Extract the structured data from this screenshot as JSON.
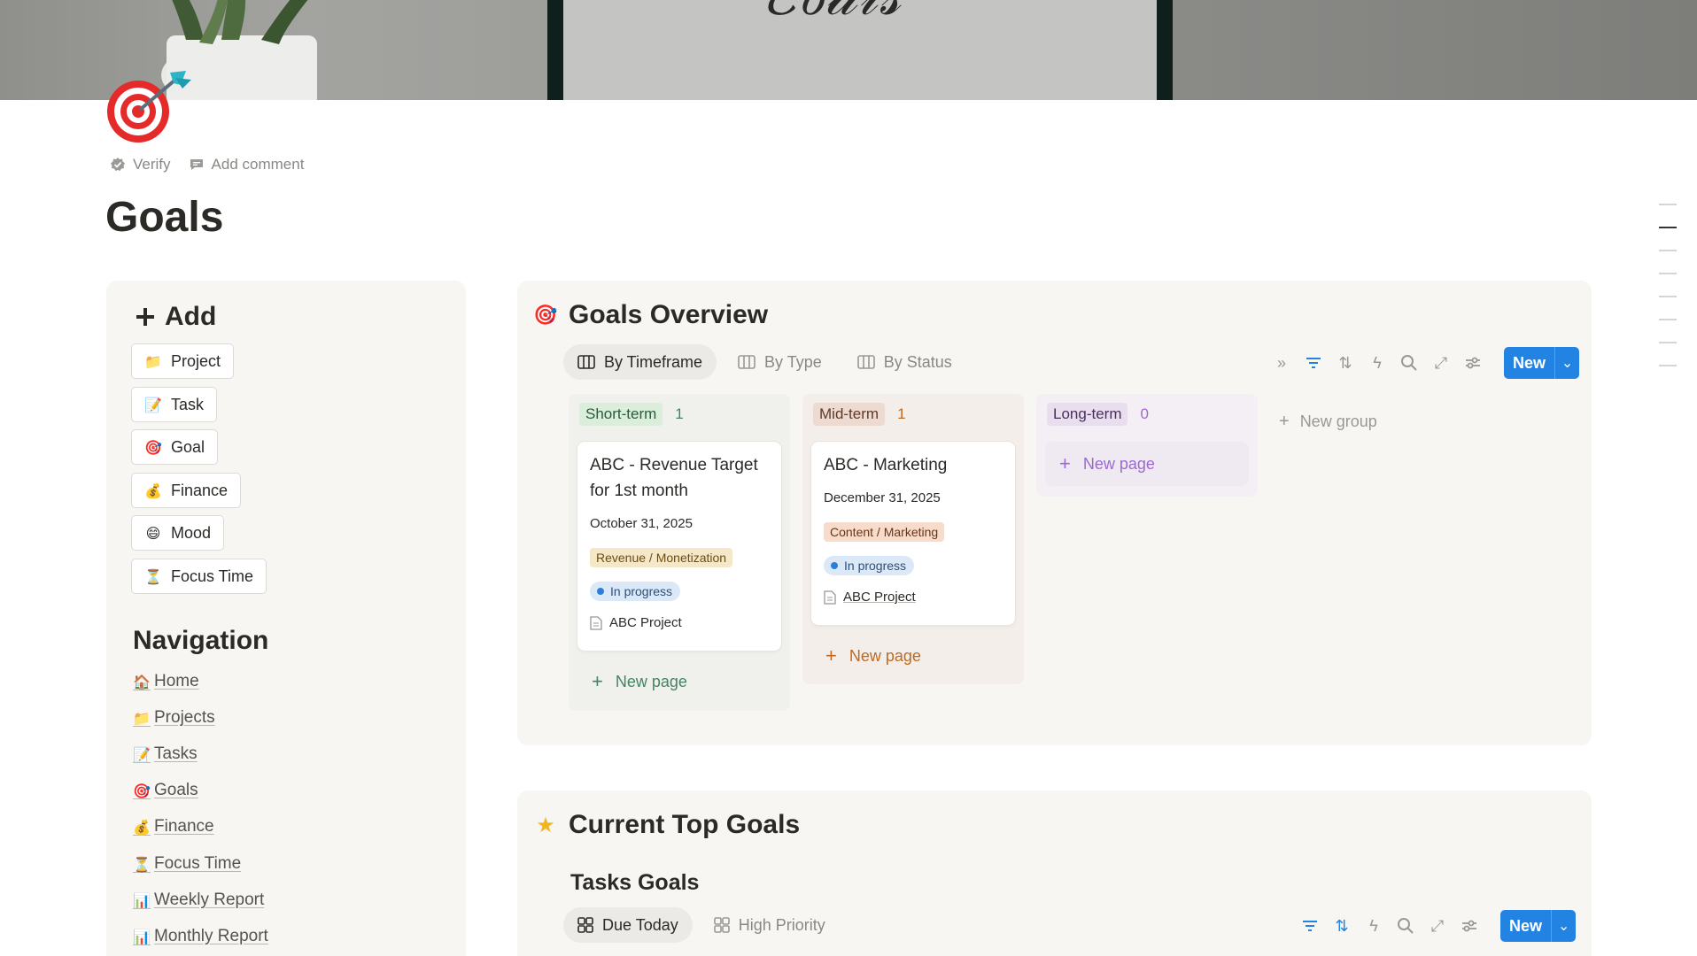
{
  "page": {
    "title": "Goals",
    "meta": {
      "verify": "Verify",
      "add_comment": "Add comment"
    }
  },
  "left_panel": {
    "add_heading": "Add",
    "add_buttons": [
      {
        "label": "Project",
        "icon": "folder-icon"
      },
      {
        "label": "Task",
        "icon": "memo-icon"
      },
      {
        "label": "Goal",
        "icon": "target-icon"
      },
      {
        "label": "Finance",
        "icon": "money-bag-icon"
      },
      {
        "label": "Mood",
        "icon": "smiley-icon"
      },
      {
        "label": "Focus Time",
        "icon": "hourglass-icon"
      }
    ],
    "navigation_heading": "Navigation",
    "nav_links": [
      {
        "label": "Home",
        "icon": "house-icon"
      },
      {
        "label": "Projects",
        "icon": "folder-icon"
      },
      {
        "label": "Tasks",
        "icon": "memo-icon"
      },
      {
        "label": "Goals",
        "icon": "target-icon"
      },
      {
        "label": "Finance",
        "icon": "money-bag-icon"
      },
      {
        "label": "Focus Time",
        "icon": "hourglass-icon"
      },
      {
        "label": "Weekly Report",
        "icon": "bar-chart-icon"
      },
      {
        "label": "Monthly Report",
        "icon": "bar-chart-icon"
      }
    ]
  },
  "overview": {
    "title": "Goals Overview",
    "tabs": [
      "By Timeframe",
      "By Type",
      "By Status"
    ],
    "new_label": "New",
    "columns": [
      {
        "name": "Short-term",
        "count": "1",
        "tag_bg": "#dbeddb",
        "tag_fg": "#2c5a3a",
        "count_fg": "#448361",
        "cards": [
          {
            "title": "ABC - Revenue Target for 1st month",
            "date": "October 31, 2025",
            "type": "Revenue / Monetization",
            "status": "In progress",
            "project": "ABC Project"
          }
        ],
        "new_page": "New page"
      },
      {
        "name": "Mid-term",
        "count": "1",
        "tag_bg": "#eddad0",
        "tag_fg": "#5d3a2a",
        "count_fg": "#c0691f",
        "cards": [
          {
            "title": "ABC - Marketing",
            "date": "December 31, 2025",
            "type": "Content / Marketing",
            "status": "In progress",
            "project": "ABC Project"
          }
        ],
        "new_page": "New page"
      },
      {
        "name": "Long-term",
        "count": "0",
        "tag_bg": "#e8deee",
        "tag_fg": "#4a2f5a",
        "count_fg": "#9d68d3",
        "cards": [],
        "new_page": "New page"
      }
    ],
    "new_group": "New group"
  },
  "top_goals": {
    "title": "Current Top Goals",
    "subheading": "Tasks Goals",
    "tabs": [
      "Due Today",
      "High Priority"
    ],
    "new_label": "New"
  }
}
